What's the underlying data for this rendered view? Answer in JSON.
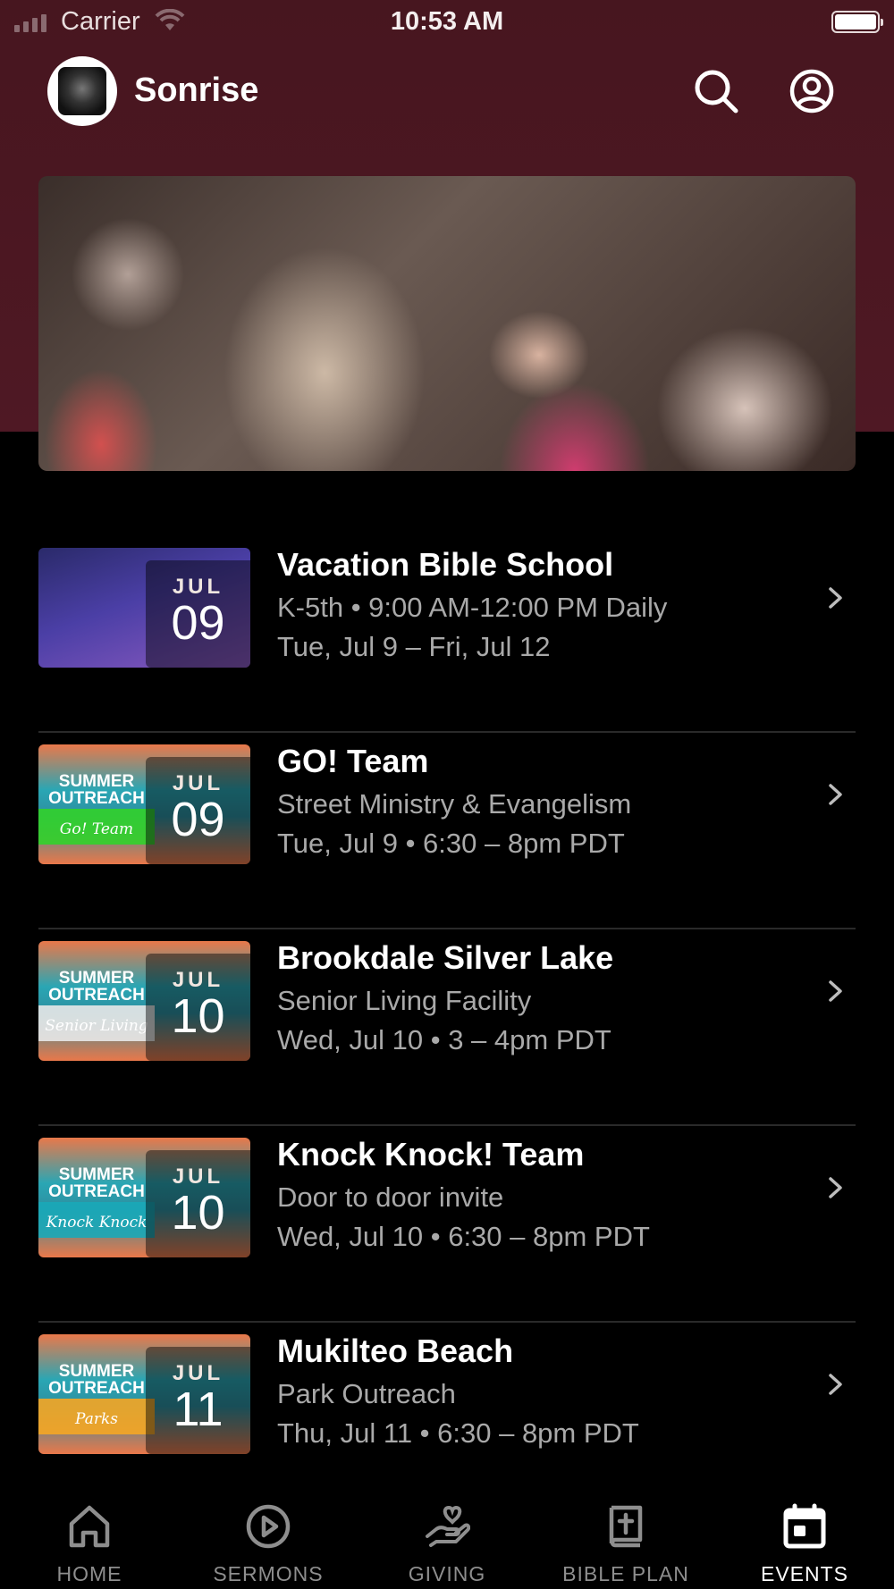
{
  "status_bar": {
    "carrier": "Carrier",
    "time": "10:53 AM"
  },
  "header": {
    "brand": "Sonrise",
    "icons": [
      "search-icon",
      "account-icon"
    ]
  },
  "hero": {
    "image": "worship-prayer-photo"
  },
  "events": [
    {
      "title": "Vacation Bible School",
      "subtitle": "K-5th • 9:00 AM-12:00 PM Daily",
      "when": "Tue, Jul 9 – Fri, Jul 12",
      "month": "JUL",
      "day": "09",
      "thumb_title": "",
      "thumb_script": "",
      "thumb_color": "#3f3f9a"
    },
    {
      "title": "GO! Team",
      "subtitle": "Street Ministry & Evangelism",
      "when": "Tue, Jul 9 • 6:30 – 8pm PDT",
      "month": "JUL",
      "day": "09",
      "thumb_title": "SUMMER OUTREACH",
      "thumb_script": "Go! Team",
      "thumb_color": "#32d12a"
    },
    {
      "title": "Brookdale Silver Lake",
      "subtitle": "Senior Living Facility",
      "when": "Wed, Jul 10 • 3 – 4pm PDT",
      "month": "JUL",
      "day": "10",
      "thumb_title": "SUMMER OUTREACH",
      "thumb_script": "Senior Living",
      "thumb_color": "#e8e8e8"
    },
    {
      "title": "Knock Knock! Team",
      "subtitle": "Door to door invite",
      "when": "Wed, Jul 10 • 6:30 – 8pm PDT",
      "month": "JUL",
      "day": "10",
      "thumb_title": "SUMMER OUTREACH",
      "thumb_script": "Knock Knock",
      "thumb_color": "#1aa8b8"
    },
    {
      "title": "Mukilteo Beach",
      "subtitle": "Park Outreach",
      "when": "Thu, Jul 11 • 6:30 – 8pm PDT",
      "month": "JUL",
      "day": "11",
      "thumb_title": "SUMMER OUTREACH",
      "thumb_script": "Parks",
      "thumb_color": "#f5a623"
    }
  ],
  "tabs": [
    {
      "label": "HOME",
      "icon": "home-icon",
      "active": false
    },
    {
      "label": "SERMONS",
      "icon": "play-circle-icon",
      "active": false
    },
    {
      "label": "GIVING",
      "icon": "giving-hand-heart-icon",
      "active": false
    },
    {
      "label": "BIBLE PLAN",
      "icon": "bible-icon",
      "active": false
    },
    {
      "label": "EVENTS",
      "icon": "calendar-icon",
      "active": true
    }
  ],
  "colors": {
    "header_bg": "#4a1720",
    "background": "#000000",
    "muted_text": "#a9a9a9",
    "inactive_tab": "#8e8e8e",
    "active_tab": "#ffffff"
  }
}
